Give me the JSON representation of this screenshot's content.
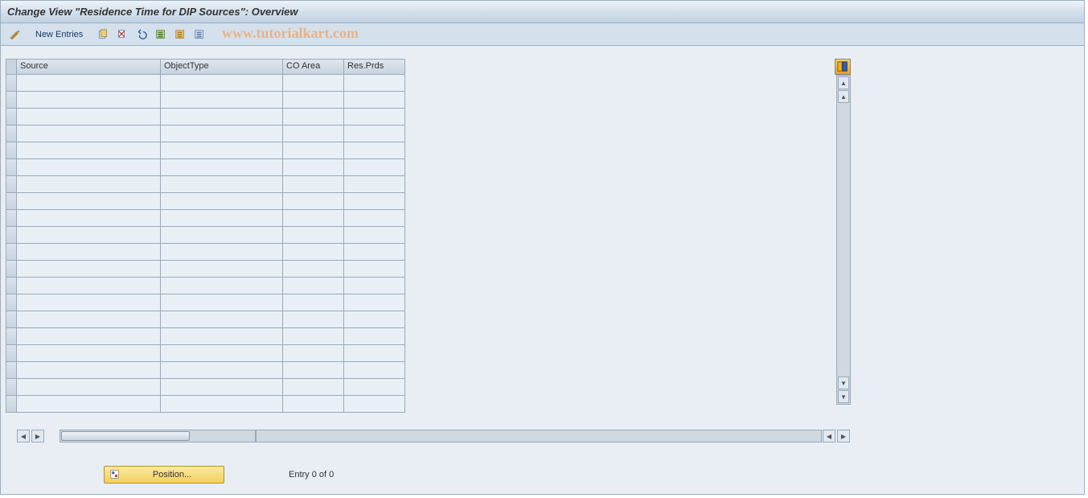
{
  "title": "Change View \"Residence Time for DIP Sources\": Overview",
  "toolbar": {
    "new_entries": "New Entries"
  },
  "watermark": "www.tutorialkart.com",
  "columns": {
    "source": "Source",
    "objecttype": "ObjectType",
    "coarea": "CO Area",
    "resprds": "Res.Prds"
  },
  "footer": {
    "position": "Position...",
    "entry": "Entry 0 of 0"
  },
  "row_count": 20
}
